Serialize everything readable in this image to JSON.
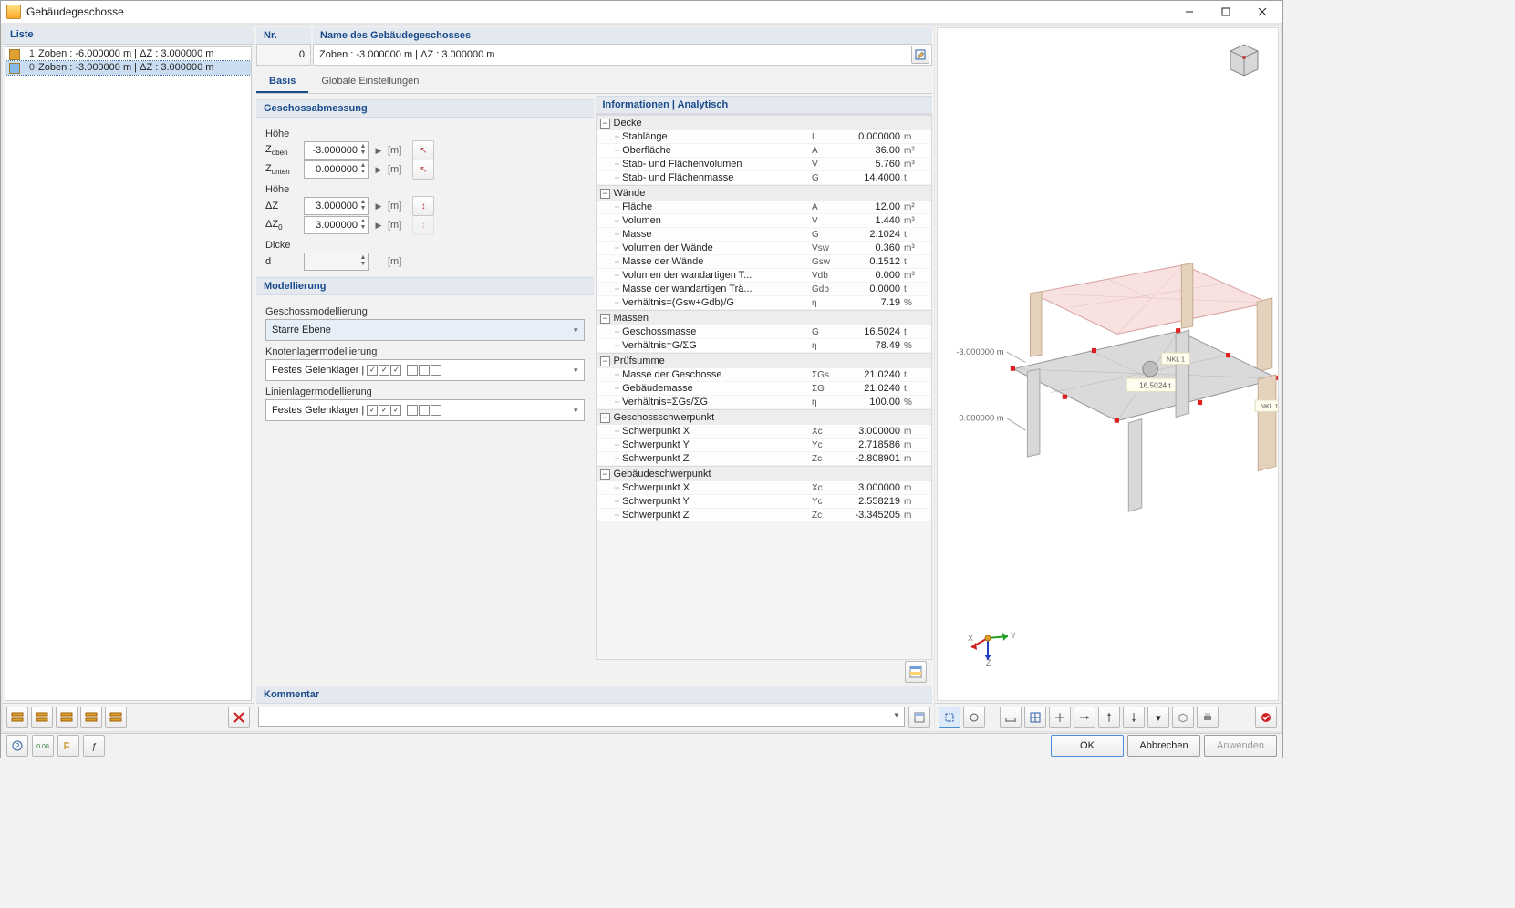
{
  "window_title": "Gebäudegeschosse",
  "list_header": "Liste",
  "list_items": [
    {
      "color": "#E0A030",
      "idx": "1",
      "label": "Zoben : -6.000000 m | ΔZ : 3.000000 m"
    },
    {
      "color": "#87B9E8",
      "idx": "0",
      "label": "Zoben : -3.000000 m | ΔZ : 3.000000 m"
    }
  ],
  "nr_header": "Nr.",
  "nr_value": "0",
  "name_header": "Name des Gebäudegeschosses",
  "name_value": "Zoben : -3.000000 m | ΔZ : 3.000000 m",
  "tabs": [
    "Basis",
    "Globale Einstellungen"
  ],
  "sec_dim": "Geschossabmessung",
  "lab_hoehe": "Höhe",
  "lab_dicke": "Dicke",
  "f_zoben_l": "Zoben",
  "f_zoben_v": "-3.000000",
  "f_zunten_l": "Zunten",
  "f_zunten_v": "0.000000",
  "f_dz_l": "ΔZ",
  "f_dz_v": "3.000000",
  "f_dz0_l": "ΔZ0",
  "f_dz0_v": "3.000000",
  "f_d_l": "d",
  "f_d_v": "",
  "unit_m": "[m]",
  "sec_model": "Modellierung",
  "lab_geschoss": "Geschossmodellierung",
  "val_starre": "Starre Ebene",
  "lab_knoten": "Knotenlagermodellierung",
  "val_festes_k": "Festes Gelenklager |",
  "lab_linien": "Linienlagermodellierung",
  "val_festes_l": "Festes Gelenklager |",
  "sec_info": "Informationen | Analytisch",
  "info_groups": [
    {
      "title": "Decke",
      "rows": [
        {
          "n": "Stablänge",
          "s": "L",
          "v": "0.000000",
          "u": "m"
        },
        {
          "n": "Oberfläche",
          "s": "A",
          "v": "36.00",
          "u": "m²"
        },
        {
          "n": "Stab- und Flächenvolumen",
          "s": "V",
          "v": "5.760",
          "u": "m³"
        },
        {
          "n": "Stab- und Flächenmasse",
          "s": "G",
          "v": "14.4000",
          "u": "t"
        }
      ]
    },
    {
      "title": "Wände",
      "rows": [
        {
          "n": "Fläche",
          "s": "A",
          "v": "12.00",
          "u": "m²"
        },
        {
          "n": "Volumen",
          "s": "V",
          "v": "1.440",
          "u": "m³"
        },
        {
          "n": "Masse",
          "s": "G",
          "v": "2.1024",
          "u": "t"
        },
        {
          "n": "Volumen der Wände",
          "s": "Vsw",
          "v": "0.360",
          "u": "m³"
        },
        {
          "n": "Masse der Wände",
          "s": "Gsw",
          "v": "0.1512",
          "u": "t"
        },
        {
          "n": "Volumen der wandartigen T...",
          "s": "Vdb",
          "v": "0.000",
          "u": "m³"
        },
        {
          "n": "Masse der wandartigen Trä...",
          "s": "Gdb",
          "v": "0.0000",
          "u": "t"
        },
        {
          "n": "Verhältnis=(Gsw+Gdb)/G",
          "s": "η",
          "v": "7.19",
          "u": "%"
        }
      ]
    },
    {
      "title": "Massen",
      "rows": [
        {
          "n": "Geschossmasse",
          "s": "G",
          "v": "16.5024",
          "u": "t"
        },
        {
          "n": "Verhältnis=G/ΣG",
          "s": "η",
          "v": "78.49",
          "u": "%"
        }
      ]
    },
    {
      "title": "Prüfsumme",
      "rows": [
        {
          "n": "Masse der Geschosse",
          "s": "ΣGs",
          "v": "21.0240",
          "u": "t"
        },
        {
          "n": "Gebäudemasse",
          "s": "ΣG",
          "v": "21.0240",
          "u": "t"
        },
        {
          "n": "Verhältnis=ΣGs/ΣG",
          "s": "η",
          "v": "100.00",
          "u": "%"
        }
      ]
    },
    {
      "title": "Geschossschwerpunkt",
      "rows": [
        {
          "n": "Schwerpunkt X",
          "s": "Xc",
          "v": "3.000000",
          "u": "m"
        },
        {
          "n": "Schwerpunkt Y",
          "s": "Yc",
          "v": "2.718586",
          "u": "m"
        },
        {
          "n": "Schwerpunkt Z",
          "s": "Zc",
          "v": "-2.808901",
          "u": "m"
        }
      ]
    },
    {
      "title": "Gebäudeschwerpunkt",
      "rows": [
        {
          "n": "Schwerpunkt X",
          "s": "Xc",
          "v": "3.000000",
          "u": "m"
        },
        {
          "n": "Schwerpunkt Y",
          "s": "Yc",
          "v": "2.558219",
          "u": "m"
        },
        {
          "n": "Schwerpunkt Z",
          "s": "Zc",
          "v": "-3.345205",
          "u": "m"
        }
      ]
    }
  ],
  "sec_comment": "Kommentar",
  "view_labels": {
    "top": "-3.000000 m",
    "bottom": "0.000000 m",
    "mass": "16.5024 t",
    "nkl": "NKL 1"
  },
  "axes": {
    "x": "X",
    "y": "Y",
    "z": "Z"
  },
  "btn_ok": "OK",
  "btn_cancel": "Abbrechen",
  "btn_apply": "Anwenden"
}
